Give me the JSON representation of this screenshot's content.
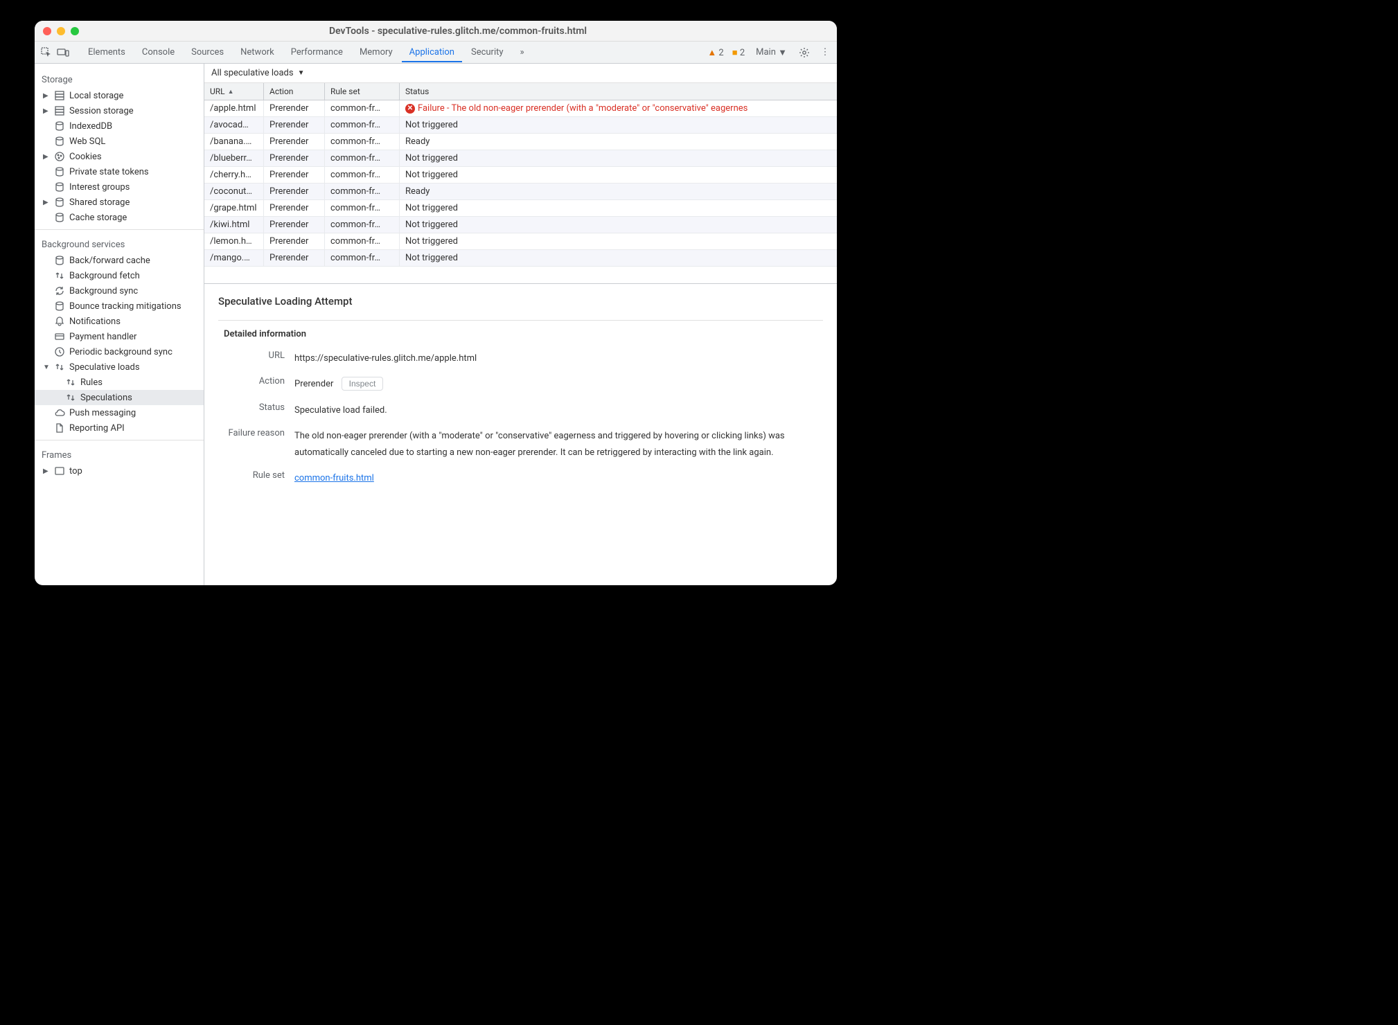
{
  "window": {
    "title": "DevTools - speculative-rules.glitch.me/common-fruits.html"
  },
  "tabs": [
    "Elements",
    "Console",
    "Sources",
    "Network",
    "Performance",
    "Memory",
    "Application",
    "Security"
  ],
  "tabs_overflow": "»",
  "active_tab": "Application",
  "warnings": {
    "warn_count": "2",
    "issue_count": "2"
  },
  "main_label": "Main",
  "sidebar": {
    "storage": {
      "title": "Storage",
      "items": [
        {
          "label": "Local storage",
          "arrow": true,
          "icon": "db"
        },
        {
          "label": "Session storage",
          "arrow": true,
          "icon": "db"
        },
        {
          "label": "IndexedDB",
          "arrow": false,
          "icon": "cyl"
        },
        {
          "label": "Web SQL",
          "arrow": false,
          "icon": "cyl"
        },
        {
          "label": "Cookies",
          "arrow": true,
          "icon": "cookie"
        },
        {
          "label": "Private state tokens",
          "arrow": false,
          "icon": "cyl"
        },
        {
          "label": "Interest groups",
          "arrow": false,
          "icon": "cyl"
        },
        {
          "label": "Shared storage",
          "arrow": true,
          "icon": "cyl"
        },
        {
          "label": "Cache storage",
          "arrow": false,
          "icon": "cyl"
        }
      ]
    },
    "background": {
      "title": "Background services",
      "items": [
        {
          "label": "Back/forward cache",
          "icon": "cyl"
        },
        {
          "label": "Background fetch",
          "icon": "updown"
        },
        {
          "label": "Background sync",
          "icon": "sync"
        },
        {
          "label": "Bounce tracking mitigations",
          "icon": "cyl"
        },
        {
          "label": "Notifications",
          "icon": "bell"
        },
        {
          "label": "Payment handler",
          "icon": "card"
        },
        {
          "label": "Periodic background sync",
          "icon": "clock"
        },
        {
          "label": "Speculative loads",
          "icon": "updown",
          "arrow_open": true,
          "children": [
            {
              "label": "Rules"
            },
            {
              "label": "Speculations",
              "selected": true
            }
          ]
        },
        {
          "label": "Push messaging",
          "icon": "cloud"
        },
        {
          "label": "Reporting API",
          "icon": "file"
        }
      ]
    },
    "frames": {
      "title": "Frames",
      "items": [
        {
          "label": "top",
          "arrow": true,
          "icon": "frame"
        }
      ]
    }
  },
  "filter": {
    "label": "All speculative loads"
  },
  "table": {
    "columns": [
      "URL",
      "Action",
      "Rule set",
      "Status"
    ],
    "rows": [
      {
        "url": "/apple.html",
        "action": "Prerender",
        "ruleset": "common-fr…",
        "status": "Failure - The old non-eager prerender (with a \"moderate\" or \"conservative\" eagernes",
        "fail": true
      },
      {
        "url": "/avocad…",
        "action": "Prerender",
        "ruleset": "common-fr…",
        "status": "Not triggered"
      },
      {
        "url": "/banana.…",
        "action": "Prerender",
        "ruleset": "common-fr…",
        "status": "Ready"
      },
      {
        "url": "/blueberr…",
        "action": "Prerender",
        "ruleset": "common-fr…",
        "status": "Not triggered"
      },
      {
        "url": "/cherry.h…",
        "action": "Prerender",
        "ruleset": "common-fr…",
        "status": "Not triggered"
      },
      {
        "url": "/coconut…",
        "action": "Prerender",
        "ruleset": "common-fr…",
        "status": "Ready"
      },
      {
        "url": "/grape.html",
        "action": "Prerender",
        "ruleset": "common-fr…",
        "status": "Not triggered"
      },
      {
        "url": "/kiwi.html",
        "action": "Prerender",
        "ruleset": "common-fr…",
        "status": "Not triggered"
      },
      {
        "url": "/lemon.h…",
        "action": "Prerender",
        "ruleset": "common-fr…",
        "status": "Not triggered"
      },
      {
        "url": "/mango.…",
        "action": "Prerender",
        "ruleset": "common-fr…",
        "status": "Not triggered"
      }
    ]
  },
  "details": {
    "heading": "Speculative Loading Attempt",
    "subheading": "Detailed information",
    "rows": {
      "url_label": "URL",
      "url_value": "https://speculative-rules.glitch.me/apple.html",
      "action_label": "Action",
      "action_value": "Prerender",
      "inspect_label": "Inspect",
      "status_label": "Status",
      "status_value": "Speculative load failed.",
      "failure_label": "Failure reason",
      "failure_value": "The old non-eager prerender (with a \"moderate\" or \"conservative\" eagerness and triggered by hovering or clicking links) was automatically canceled due to starting a new non-eager prerender. It can be retriggered by interacting with the link again.",
      "ruleset_label": "Rule set",
      "ruleset_value": "common-fruits.html"
    }
  }
}
